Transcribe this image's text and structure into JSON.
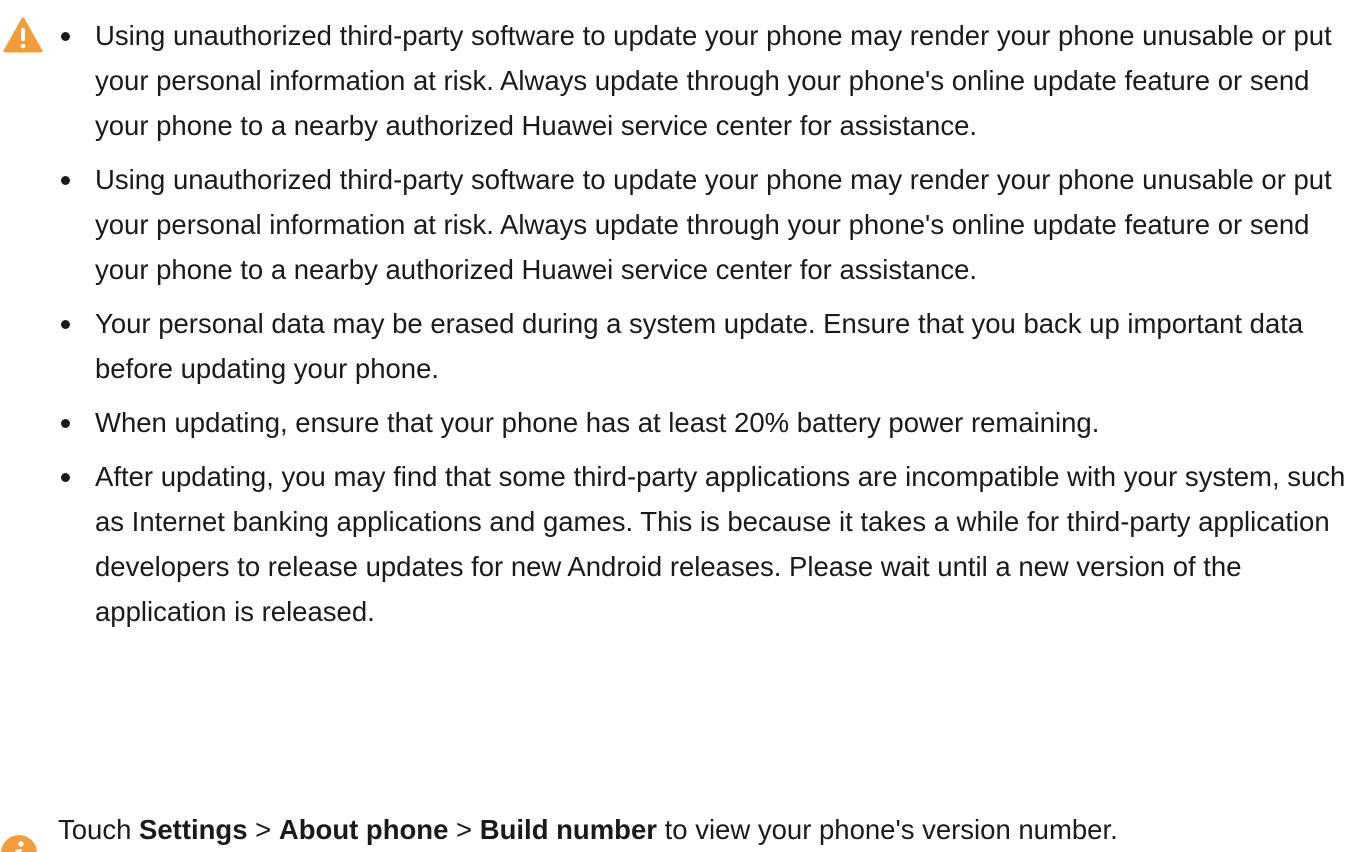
{
  "warning": {
    "icon": "warning-triangle-icon",
    "icon_color": "#f39c3c",
    "items": [
      "Using unauthorized third-party software to update your phone may render your phone unusable or put your personal information at risk. Always update through your phone's online update feature or send your phone to a nearby authorized Huawei service center for assistance.",
      "Using unauthorized third-party software to update your phone may render your phone unusable or put your personal information at risk. Always update through your phone's online update feature or send your phone to a nearby authorized Huawei service center for assistance.",
      "Your personal data may be erased during a system update. Ensure that you back up important data before updating your phone.",
      "When updating, ensure that your phone has at least 20% battery power remaining.",
      "After updating, you may find that some third-party applications are incompatible with your system, such as Internet banking applications and games. This is because it takes a while for third-party application developers to release updates for new Android releases. Please wait until a new version of the application is released."
    ]
  },
  "note": {
    "icon": "info-icon",
    "icon_color": "#f39c3c",
    "prefix": "Touch ",
    "settings": "Settings",
    "sep1": " > ",
    "about_phone": "About phone",
    "sep2": " > ",
    "build_number": "Build number",
    "suffix": " to view your phone's version number."
  }
}
